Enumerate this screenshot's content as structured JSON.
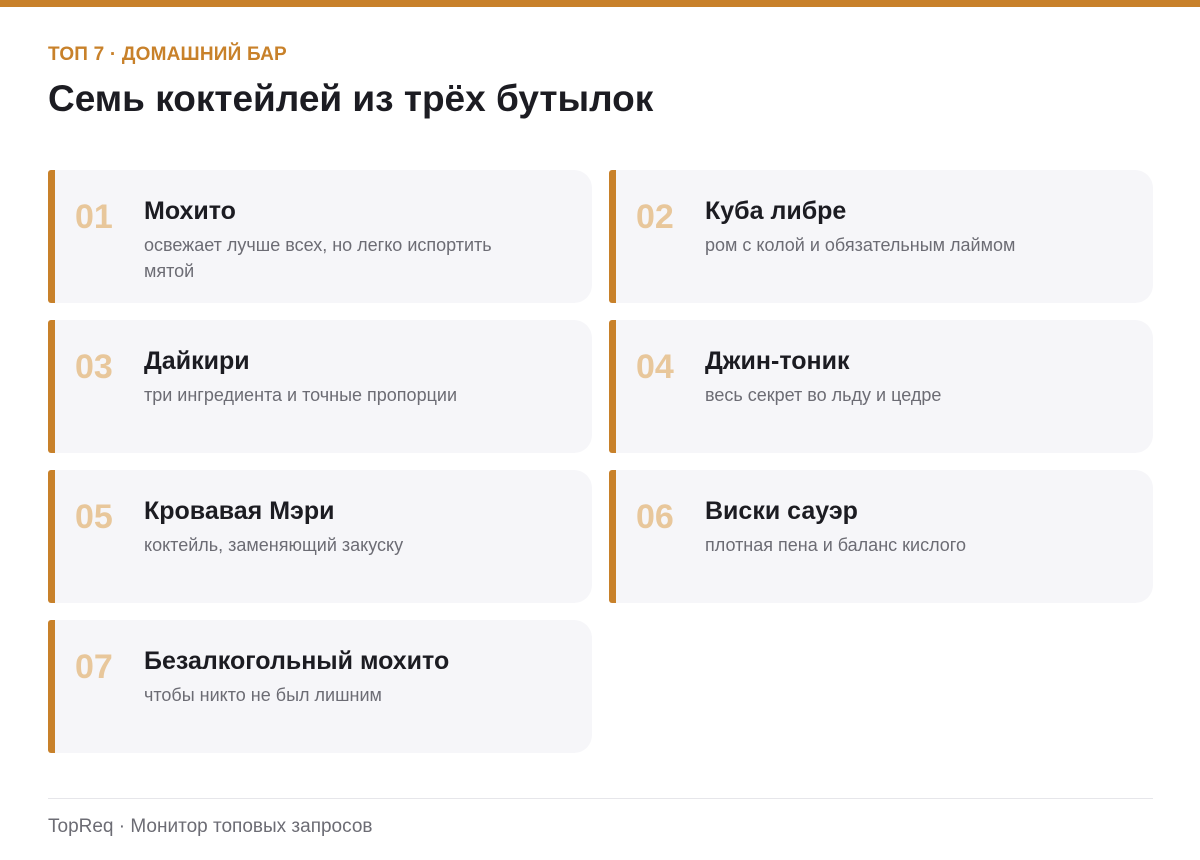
{
  "header": {
    "eyebrow": "ТОП 7 · ДОМАШНИЙ БАР",
    "title": "Семь коктейлей из трёх бутылок"
  },
  "items": [
    {
      "num": "01",
      "name": "Мохито",
      "desc": "освежает лучше всех, но легко испортить мятой"
    },
    {
      "num": "02",
      "name": "Куба либре",
      "desc": "ром с колой и обязательным лаймом"
    },
    {
      "num": "03",
      "name": "Дайкири",
      "desc": "три ингредиента и точные пропорции"
    },
    {
      "num": "04",
      "name": "Джин-тоник",
      "desc": "весь секрет во льду и цедре"
    },
    {
      "num": "05",
      "name": "Кровавая Мэри",
      "desc": "коктейль, заменяющий закуску"
    },
    {
      "num": "06",
      "name": "Виски сауэр",
      "desc": "плотная пена и баланс кислого"
    },
    {
      "num": "07",
      "name": "Безалкогольный мохито",
      "desc": "чтобы никто не был лишним"
    }
  ],
  "footer": {
    "text": "TopReq · Монитор топовых запросов"
  },
  "colors": {
    "accent": "#c8812a",
    "number": "#e8c79b",
    "card_bg": "#f6f6f9"
  }
}
